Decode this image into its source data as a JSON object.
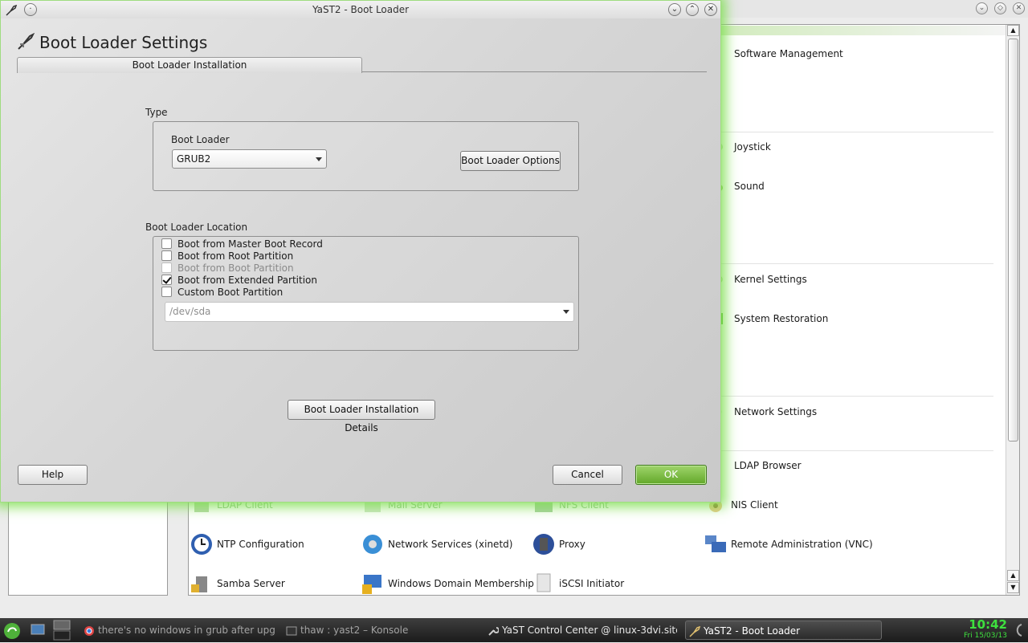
{
  "background_window": {
    "items": [
      {
        "label": "Software Management",
        "faded": false
      },
      {
        "label": "Joystick",
        "faded": false
      },
      {
        "label": "Sound",
        "faded": false
      },
      {
        "label": "Kernel Settings",
        "faded": false
      },
      {
        "label": "System Restoration",
        "faded": false
      },
      {
        "label": "Network Settings",
        "faded": false
      },
      {
        "label": "LDAP Browser",
        "faded": false
      },
      {
        "label": "LDAP Client",
        "faded": true
      },
      {
        "label": "Mail Server",
        "faded": true
      },
      {
        "label": "NFS Client",
        "faded": true
      },
      {
        "label": "NIS Client",
        "faded": false
      },
      {
        "label": "NTP Configuration",
        "faded": false
      },
      {
        "label": "Network Services (xinetd)",
        "faded": false
      },
      {
        "label": "Proxy",
        "faded": false
      },
      {
        "label": "Remote Administration (VNC)",
        "faded": false
      },
      {
        "label": "Samba Server",
        "faded": false
      },
      {
        "label": "Windows Domain Membership",
        "faded": false
      },
      {
        "label": "iSCSI Initiator",
        "faded": false
      }
    ]
  },
  "dialog": {
    "window_title": "YaST2 - Boot Loader",
    "page_title": "Boot Loader Settings",
    "tab_label": "Boot Loader Installation",
    "type_group": {
      "label": "Type",
      "boot_loader_label": "Boot Loader",
      "boot_loader_value": "GRUB2",
      "options_button": "Boot Loader Options"
    },
    "location_group": {
      "label": "Boot Loader Location",
      "options": [
        {
          "label": "Boot from Master Boot Record",
          "checked": false,
          "enabled": true
        },
        {
          "label": "Boot from Root Partition",
          "checked": false,
          "enabled": true
        },
        {
          "label": "Boot from Boot Partition",
          "checked": false,
          "enabled": false
        },
        {
          "label": "Boot from Extended Partition",
          "checked": true,
          "enabled": true
        },
        {
          "label": "Custom Boot Partition",
          "checked": false,
          "enabled": true
        }
      ],
      "custom_partition_value": "/dev/sda"
    },
    "details_button": "Boot Loader Installation Details",
    "help_button": "Help",
    "cancel_button": "Cancel",
    "ok_button": "OK"
  },
  "taskbar": {
    "tasks": [
      {
        "label": "there's no windows in grub after upgrad",
        "active": false
      },
      {
        "label": "thaw : yast2 – Konsole",
        "active": false
      },
      {
        "label": "YaST Control Center @ linux-3dvi.site",
        "active": false
      },
      {
        "label": "YaST2 - Boot Loader",
        "active": true
      }
    ],
    "clock_time": "10:42",
    "clock_date": "Fri 15/03/13"
  },
  "colors": {
    "accent_green": "#62a829",
    "glow_green": "#7ede50",
    "clock_green": "#3ee03e"
  }
}
